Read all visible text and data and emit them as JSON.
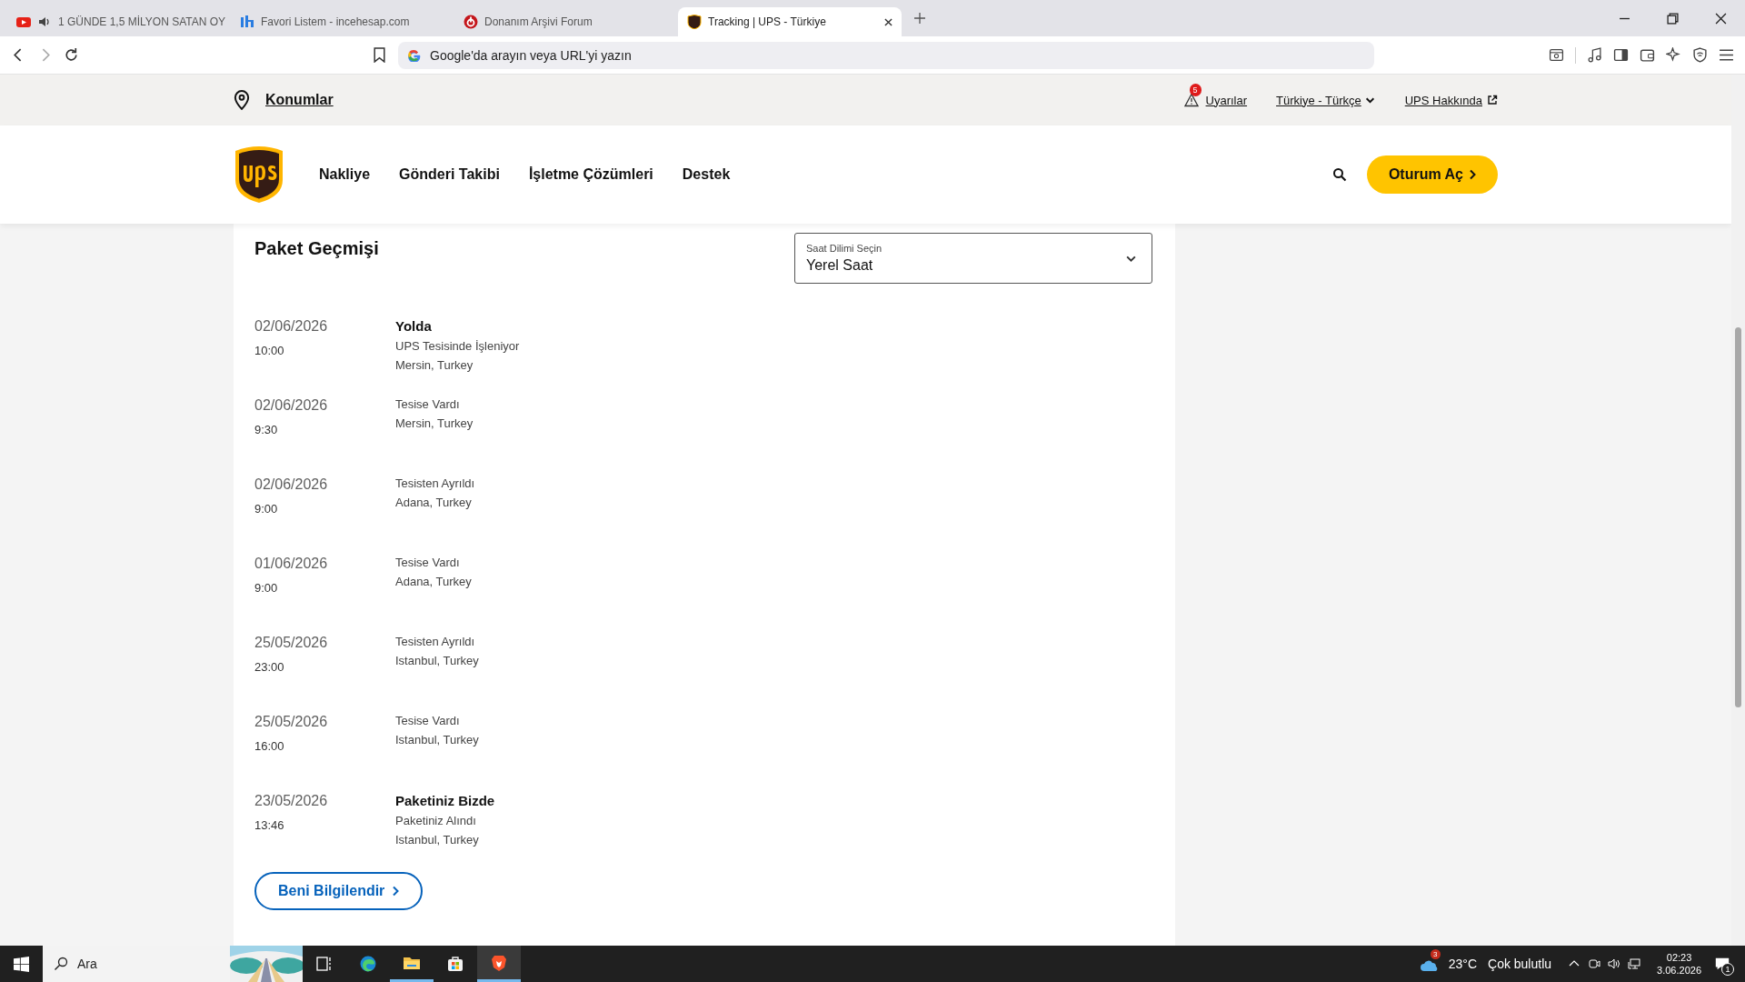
{
  "browser": {
    "tabs": [
      {
        "title": "1 GÜNDE 1,5 MİLYON SATAN OY",
        "audio": true,
        "selected": false
      },
      {
        "title": "Favori Listem - incehesap.com",
        "audio": false,
        "selected": false
      },
      {
        "title": "Donanım Arşivi Forum",
        "audio": false,
        "selected": false
      },
      {
        "title": "Tracking | UPS - Türkiye",
        "audio": false,
        "selected": true
      }
    ],
    "address": {
      "placeholder": "Google'da arayın veya URL'yi yazın"
    }
  },
  "utility_bar": {
    "locations": "Konumlar",
    "alerts": {
      "label": "Uyarılar",
      "count": "5"
    },
    "language": "Türkiye - Türkçe",
    "about": "UPS Hakkında"
  },
  "nav": {
    "items": [
      "Nakliye",
      "Gönderi Takibi",
      "İşletme Çözümleri",
      "Destek"
    ],
    "sign_in": "Oturum Aç"
  },
  "history": {
    "title": "Paket Geçmişi",
    "timezone": {
      "label": "Saat Dilimi Seçin",
      "value": "Yerel Saat"
    },
    "events": [
      {
        "date": "02/06/2026",
        "time": "10:00",
        "status": "Yolda",
        "description": "UPS Tesisinde İşleniyor",
        "location": "Mersin, Turkey"
      },
      {
        "date": "02/06/2026",
        "time": "9:30",
        "description": "Tesise Vardı",
        "location": "Mersin, Turkey"
      },
      {
        "date": "02/06/2026",
        "time": "9:00",
        "description": "Tesisten Ayrıldı",
        "location": "Adana, Turkey"
      },
      {
        "date": "01/06/2026",
        "time": "9:00",
        "description": "Tesise Vardı",
        "location": "Adana, Turkey"
      },
      {
        "date": "25/05/2026",
        "time": "23:00",
        "description": "Tesisten Ayrıldı",
        "location": "Istanbul, Turkey"
      },
      {
        "date": "25/05/2026",
        "time": "16:00",
        "description": "Tesise Vardı",
        "location": "Istanbul, Turkey"
      },
      {
        "date": "23/05/2026",
        "time": "13:46",
        "status": "Paketiniz Bizde",
        "description": "Paketiniz Alındı",
        "location": "Istanbul, Turkey"
      }
    ],
    "notify_button": "Beni Bilgilendir"
  },
  "taskbar": {
    "search": {
      "placeholder": "Ara"
    },
    "weather": {
      "badge": "3",
      "temperature": "23°C",
      "condition": "Çok bulutlu"
    },
    "time": "02:23",
    "date": "3.06.2026",
    "notifications": "1"
  }
}
